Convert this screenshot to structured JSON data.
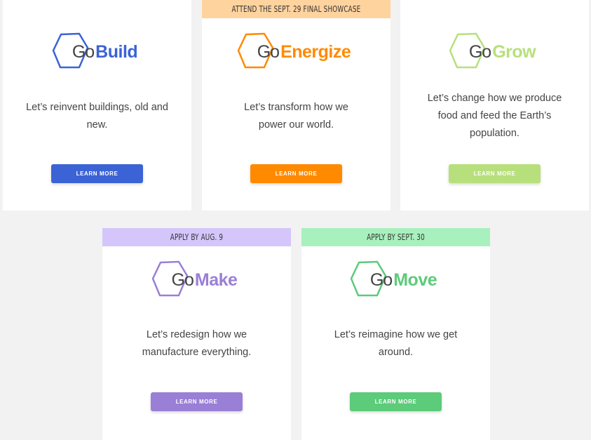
{
  "cards": [
    {
      "id": "build",
      "banner": "",
      "go": "Go",
      "word": "Build",
      "description": "Let’s reinvent buildings, old and new.",
      "button": "LEARN MORE",
      "color": "#3b63d6",
      "banner_color": ""
    },
    {
      "id": "energize",
      "banner": "ATTEND THE SEPT. 29 FINAL SHOWCASE",
      "go": "Go",
      "word": "Energize",
      "description": "Let’s transform how we power our world.",
      "button": "LEARN MORE",
      "color": "#ff8a00",
      "banner_color": "#ffd39e"
    },
    {
      "id": "grow",
      "banner": "",
      "go": "Go",
      "word": "Grow",
      "description": "Let’s change how we produce food and feed the Earth’s population.",
      "button": "LEARN MORE",
      "color": "#b7e07c",
      "banner_color": ""
    },
    {
      "id": "make",
      "banner": "APPLY BY AUG. 9",
      "go": "Go",
      "word": "Make",
      "description": "Let’s redesign how we manufacture everything.",
      "button": "LEARN MORE",
      "color": "#9a7fd6",
      "banner_color": "#d4c6fb"
    },
    {
      "id": "move",
      "banner": "APPLY BY SEPT. 30",
      "go": "Go",
      "word": "Move",
      "description": "Let’s reimagine how we get around.",
      "button": "LEARN MORE",
      "color": "#5ccb7a",
      "banner_color": "#a8f0bd"
    }
  ],
  "icons": {
    "logo": "hexagon-outline-icon"
  }
}
